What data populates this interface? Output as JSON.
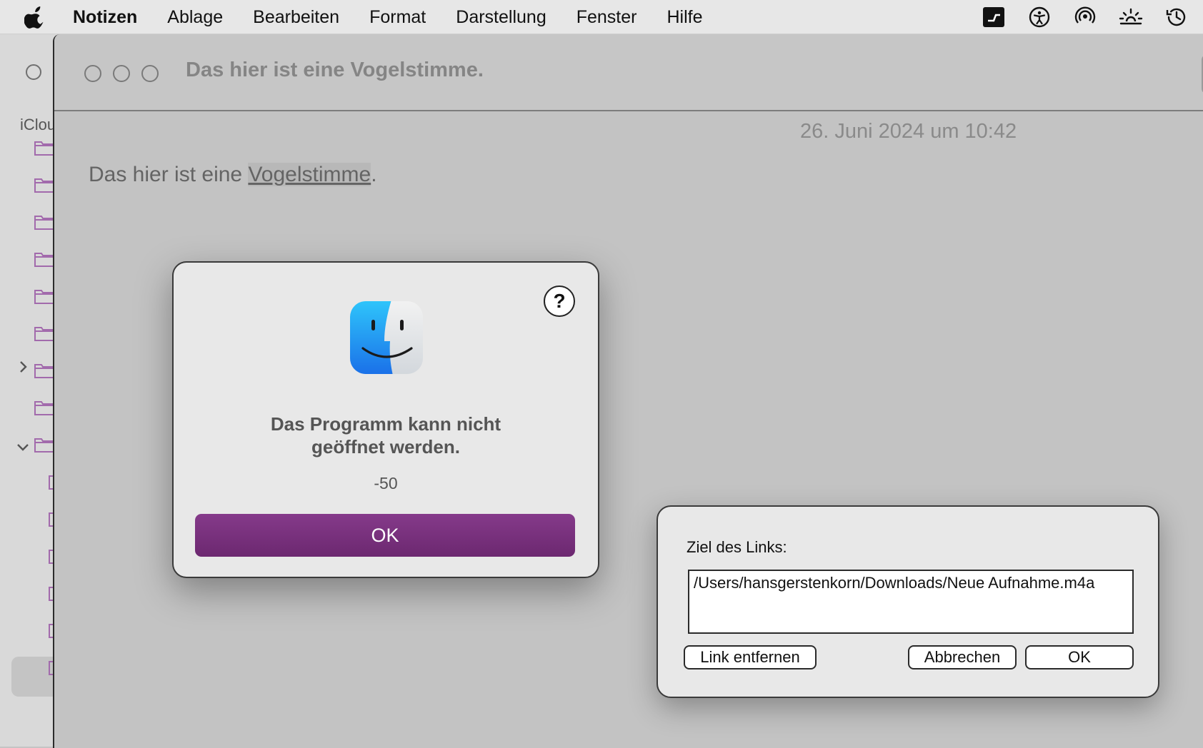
{
  "menubar": {
    "items": [
      "Notizen",
      "Ablage",
      "Bearbeiten",
      "Format",
      "Darstellung",
      "Fenster",
      "Hilfe"
    ]
  },
  "status_icons": [
    "controller-icon",
    "accessibility-icon",
    "airdrop-icon",
    "brightness-icon",
    "time-machine-icon"
  ],
  "sidebar": {
    "account_label": "iClou"
  },
  "note": {
    "window_title": "Das hier ist eine Vogelstimme.",
    "date": "26. Juni 2024 um 10:42",
    "body_prefix": "Das hier ist eine ",
    "body_link": "Vogelstimme",
    "body_suffix": "."
  },
  "alert": {
    "help_label": "?",
    "title": "Das Programm kann nicht\ngeöffnet werden.",
    "code": "-50",
    "ok_label": "OK"
  },
  "link_dialog": {
    "label": "Ziel des Links:",
    "value": "/Users/hansgerstenkorn/Downloads/Neue Aufnahme.m4a",
    "remove_label": "Link entfernen",
    "cancel_label": "Abbrechen",
    "ok_label": "OK"
  },
  "colors": {
    "accent": "#7a3180",
    "folder": "#a26aac"
  }
}
